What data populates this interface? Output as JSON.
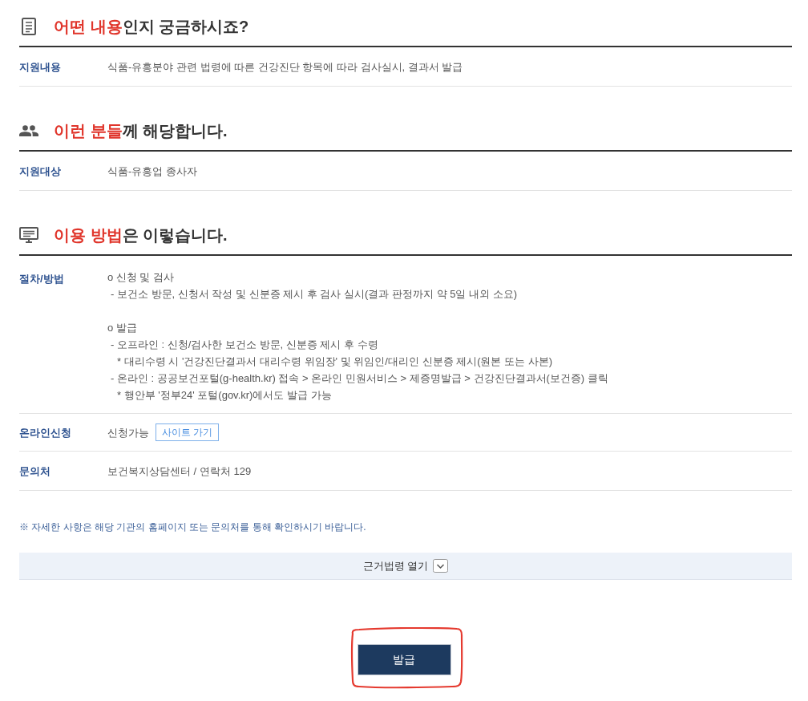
{
  "sections": [
    {
      "title": [
        {
          "text": "어떤 내용",
          "highlight": true
        },
        {
          "text": "인지 궁금하시죠?",
          "highlight": false
        }
      ],
      "rows": [
        {
          "kind": "text",
          "label": "지원내용",
          "value": "식품-유흥분야 관련 법령에 따른 건강진단 항목에 따라 검사실시, 결과서 발급"
        }
      ]
    },
    {
      "title": [
        {
          "text": "이런 분들",
          "highlight": true
        },
        {
          "text": "께 해당합니다.",
          "highlight": false
        }
      ],
      "rows": [
        {
          "kind": "text",
          "label": "지원대상",
          "value": "식품-유흥업 종사자"
        }
      ]
    },
    {
      "title": [
        {
          "text": "이용 방법",
          "highlight": true
        },
        {
          "text": "은 이렇습니다.",
          "highlight": false
        }
      ],
      "rows": [
        {
          "kind": "outline",
          "label": "절차/방법",
          "items": [
            {
              "text": "o 신청 및 검사",
              "children": [
                {
                  "text": "- 보건소 방문, 신청서 작성 및 신분증 제시 후 검사 실시(결과 판정까지 약 5일 내외 소요)"
                }
              ]
            },
            {
              "text": "o 발급",
              "children": [
                {
                  "text": "- 오프라인 : 신청/검사한 보건소 방문, 신분증 제시 후 수령",
                  "children": [
                    {
                      "text": "* 대리수령 시 '건강진단결과서 대리수령 위임장' 및 위임인/대리인 신분증 제시(원본 또는 사본)"
                    }
                  ]
                },
                {
                  "text": "- 온라인 : 공공보건포털(g-health.kr) 접속 > 온라인 민원서비스 > 제증명발급 > 건강진단결과서(보건증) 클릭",
                  "children": [
                    {
                      "text": "* 행안부 '정부24' 포털(gov.kr)에서도 발급 가능"
                    }
                  ]
                }
              ]
            }
          ]
        },
        {
          "kind": "link",
          "label": "온라인신청",
          "value": "신청가능",
          "link": "사이트 가기"
        },
        {
          "kind": "text",
          "label": "문의처",
          "value": "보건복지상담센터 / 연락처 129"
        }
      ]
    }
  ],
  "notice": "※ 자세한 사항은 해당 기관의 홈페이지 또는 문의처를 통해 확인하시기 바랍니다.",
  "legal_basis": {
    "label": "근거법령 열기",
    "expanded": false
  },
  "issue_button": {
    "label": "발급",
    "circled": true
  }
}
